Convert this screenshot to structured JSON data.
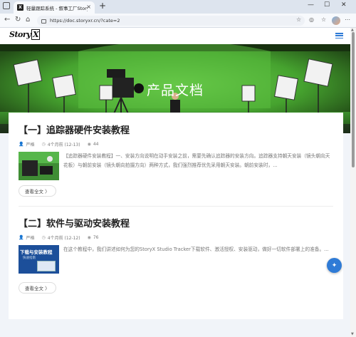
{
  "browser": {
    "tab_title": "轻量跟踪系统 - 叙事工厂StoryX",
    "tab_favicon": "X",
    "url": "https://doc.storyxr.cn/?cate=2",
    "new_tab_icon": "+",
    "close_icon": "×",
    "minimize": "—",
    "maximize": "☐",
    "close_window": "✕"
  },
  "site": {
    "logo_text": "Story",
    "logo_x": "X",
    "hero_title": "产品文档",
    "accent_color": "#2f7bd6"
  },
  "articles": [
    {
      "title": "【一】追踪器硬件安装教程",
      "author": "严格",
      "date": "4个月前 (12-13)",
      "views": "44",
      "summary": "【追踪器硬件安装教程】一、安装方向说明在动手安装之前，需要先确认追踪器的安装方向。追踪器支持朝天安装（镜头朝向天花板）与朝前安装（镜头朝向拍摄方向）两种方式，我们强烈推荐优先采用朝天安装。朝前安装时，...",
      "read_more": "查看全文 〉"
    },
    {
      "title": "【二】软件与驱动安装教程",
      "author": "严格",
      "date": "4个月前 (12-12)",
      "views": "76",
      "summary": "在这个教程中，我们讲述如何为您的StoryX Studio Tracker下载软件、激活授权、安装驱动，做好一切软件部署上的准备。...",
      "read_more": "查看全文 〉",
      "thumb_text_1": "下载与安装教程",
      "thumb_text_2": "快速指南"
    }
  ]
}
